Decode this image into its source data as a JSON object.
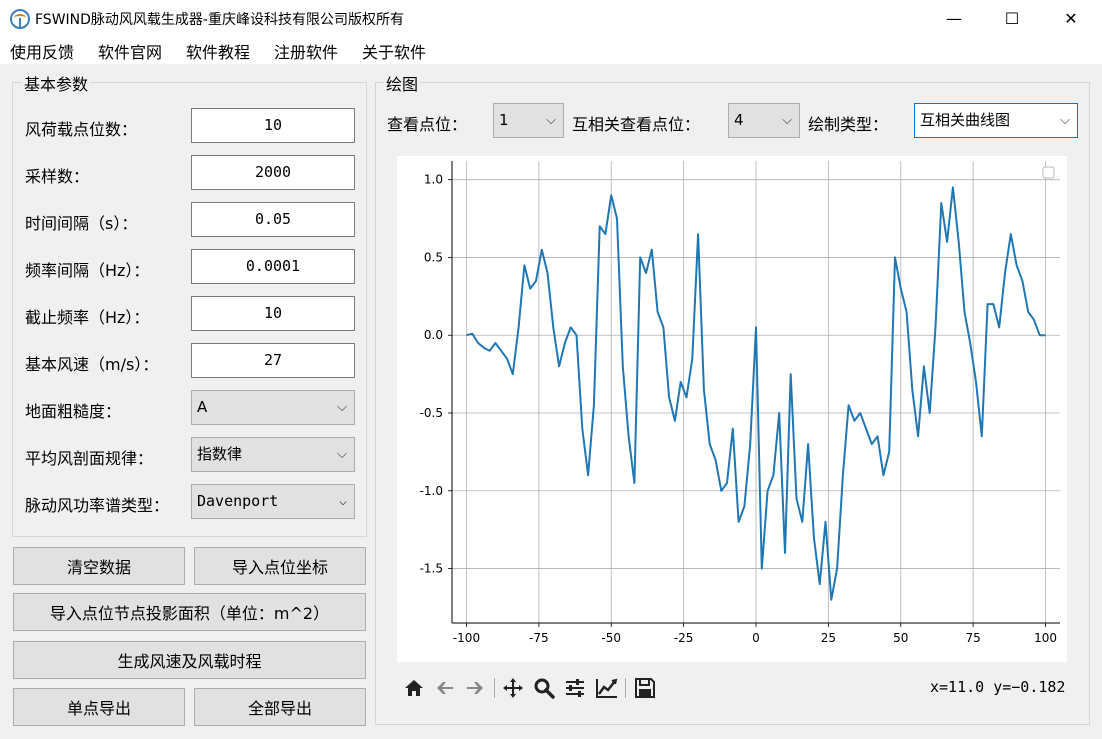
{
  "window": {
    "title": "FSWIND脉动风风载生成器-重庆峰设科技有限公司版权所有",
    "minimize_glyph": "—",
    "maximize_glyph": "☐",
    "close_glyph": "✕"
  },
  "menu": [
    "使用反馈",
    "软件官网",
    "软件教程",
    "注册软件",
    "关于软件"
  ],
  "params": {
    "group_title": "基本参数",
    "fields": [
      {
        "label": "风荷载点位数：",
        "value": "10"
      },
      {
        "label": "采样数：",
        "value": "2000"
      },
      {
        "label": "时间间隔（s）：",
        "value": "0.05"
      },
      {
        "label": "频率间隔（Hz）：",
        "value": "0.0001"
      },
      {
        "label": "截止频率（Hz）：",
        "value": "10"
      },
      {
        "label": "基本风速（m/s）：",
        "value": "27"
      }
    ],
    "selects": [
      {
        "label": "地面粗糙度：",
        "value": "A"
      },
      {
        "label": "平均风剖面规律：",
        "value": "指数律"
      },
      {
        "label": "脉动风功率谱类型：",
        "value": "Davenport"
      }
    ]
  },
  "buttons": {
    "clear": "清空数据",
    "import_coords": "导入点位坐标",
    "import_area": "导入点位节点投影面积（单位：m^2）",
    "generate": "生成风速及风载时程",
    "export_single": "单点导出",
    "export_all": "全部导出"
  },
  "plot_panel": {
    "group_title": "绘图",
    "view_point_label": "查看点位：",
    "view_point_value": "1",
    "cross_point_label": "互相关查看点位：",
    "cross_point_value": "4",
    "draw_type_label": "绘制类型：",
    "draw_type_value": "互相关曲线图",
    "coords_readout": "x=11.0  y=−0.182"
  },
  "colors": {
    "line": "#1f77b4",
    "grid": "#b0b0b0",
    "selected_border": "#0078d7"
  },
  "toolbar_icons": [
    "home-icon",
    "back-arrow-icon",
    "forward-arrow-icon",
    "pan-icon",
    "zoom-icon",
    "subplots-config-icon",
    "edit-curve-icon",
    "save-icon"
  ],
  "chart_data": {
    "type": "line",
    "title": "",
    "xlabel": "",
    "ylabel": "",
    "xlim": [
      -105,
      105
    ],
    "ylim": [
      -1.85,
      1.12
    ],
    "xticks": [
      "-100",
      "-75",
      "-50",
      "-25",
      "0",
      "25",
      "50",
      "75",
      "100"
    ],
    "xtick_values": [
      -100,
      -75,
      -50,
      -25,
      0,
      25,
      50,
      75,
      100
    ],
    "yticks": [
      "1.0",
      "0.5",
      "0.0",
      "-0.5",
      "-1.0",
      "-1.5"
    ],
    "ytick_values": [
      1.0,
      0.5,
      0.0,
      -0.5,
      -1.0,
      -1.5
    ],
    "grid": true,
    "series": [
      {
        "x": [
          -100,
          -98,
          -96,
          -94,
          -92,
          -90,
          -88,
          -86,
          -84,
          -82,
          -80,
          -78,
          -76,
          -74,
          -72,
          -70,
          -68,
          -66,
          -64,
          -62,
          -60,
          -58,
          -56,
          -54,
          -52,
          -50,
          -48,
          -46,
          -44,
          -42,
          -40,
          -38,
          -36,
          -34,
          -32,
          -30,
          -28,
          -26,
          -24,
          -22,
          -20,
          -18,
          -16,
          -14,
          -12,
          -10,
          -8,
          -6,
          -4,
          -2,
          0,
          2,
          4,
          6,
          8,
          10,
          12,
          14,
          16,
          18,
          20,
          22,
          24,
          26,
          28,
          30,
          32,
          34,
          36,
          38,
          40,
          42,
          44,
          46,
          48,
          50,
          52,
          54,
          56,
          58,
          60,
          62,
          64,
          66,
          68,
          70,
          72,
          74,
          76,
          78,
          80,
          82,
          84,
          86,
          88,
          90,
          92,
          94,
          96,
          98,
          100
        ],
        "y": [
          0.0,
          0.01,
          -0.05,
          -0.08,
          -0.1,
          -0.05,
          -0.1,
          -0.15,
          -0.25,
          0.05,
          0.45,
          0.3,
          0.35,
          0.55,
          0.4,
          0.05,
          -0.2,
          -0.05,
          0.05,
          0.0,
          -0.6,
          -0.9,
          -0.45,
          0.7,
          0.65,
          0.9,
          0.75,
          -0.2,
          -0.65,
          -0.95,
          0.5,
          0.4,
          0.55,
          0.15,
          0.05,
          -0.4,
          -0.55,
          -0.3,
          -0.4,
          -0.15,
          0.65,
          -0.35,
          -0.7,
          -0.8,
          -1.0,
          -0.95,
          -0.6,
          -1.2,
          -1.1,
          -0.7,
          0.05,
          -1.5,
          -1.0,
          -0.9,
          -0.5,
          -1.4,
          -0.25,
          -1.05,
          -1.2,
          -0.7,
          -1.3,
          -1.6,
          -1.2,
          -1.7,
          -1.5,
          -0.9,
          -0.45,
          -0.55,
          -0.5,
          -0.6,
          -0.7,
          -0.65,
          -0.9,
          -0.75,
          0.5,
          0.3,
          0.15,
          -0.35,
          -0.65,
          -0.2,
          -0.5,
          0.05,
          0.85,
          0.6,
          0.95,
          0.6,
          0.15,
          -0.05,
          -0.3,
          -0.65,
          0.2,
          0.2,
          0.05,
          0.4,
          0.65,
          0.45,
          0.35,
          0.15,
          0.1,
          0.0,
          0.0
        ]
      }
    ]
  }
}
